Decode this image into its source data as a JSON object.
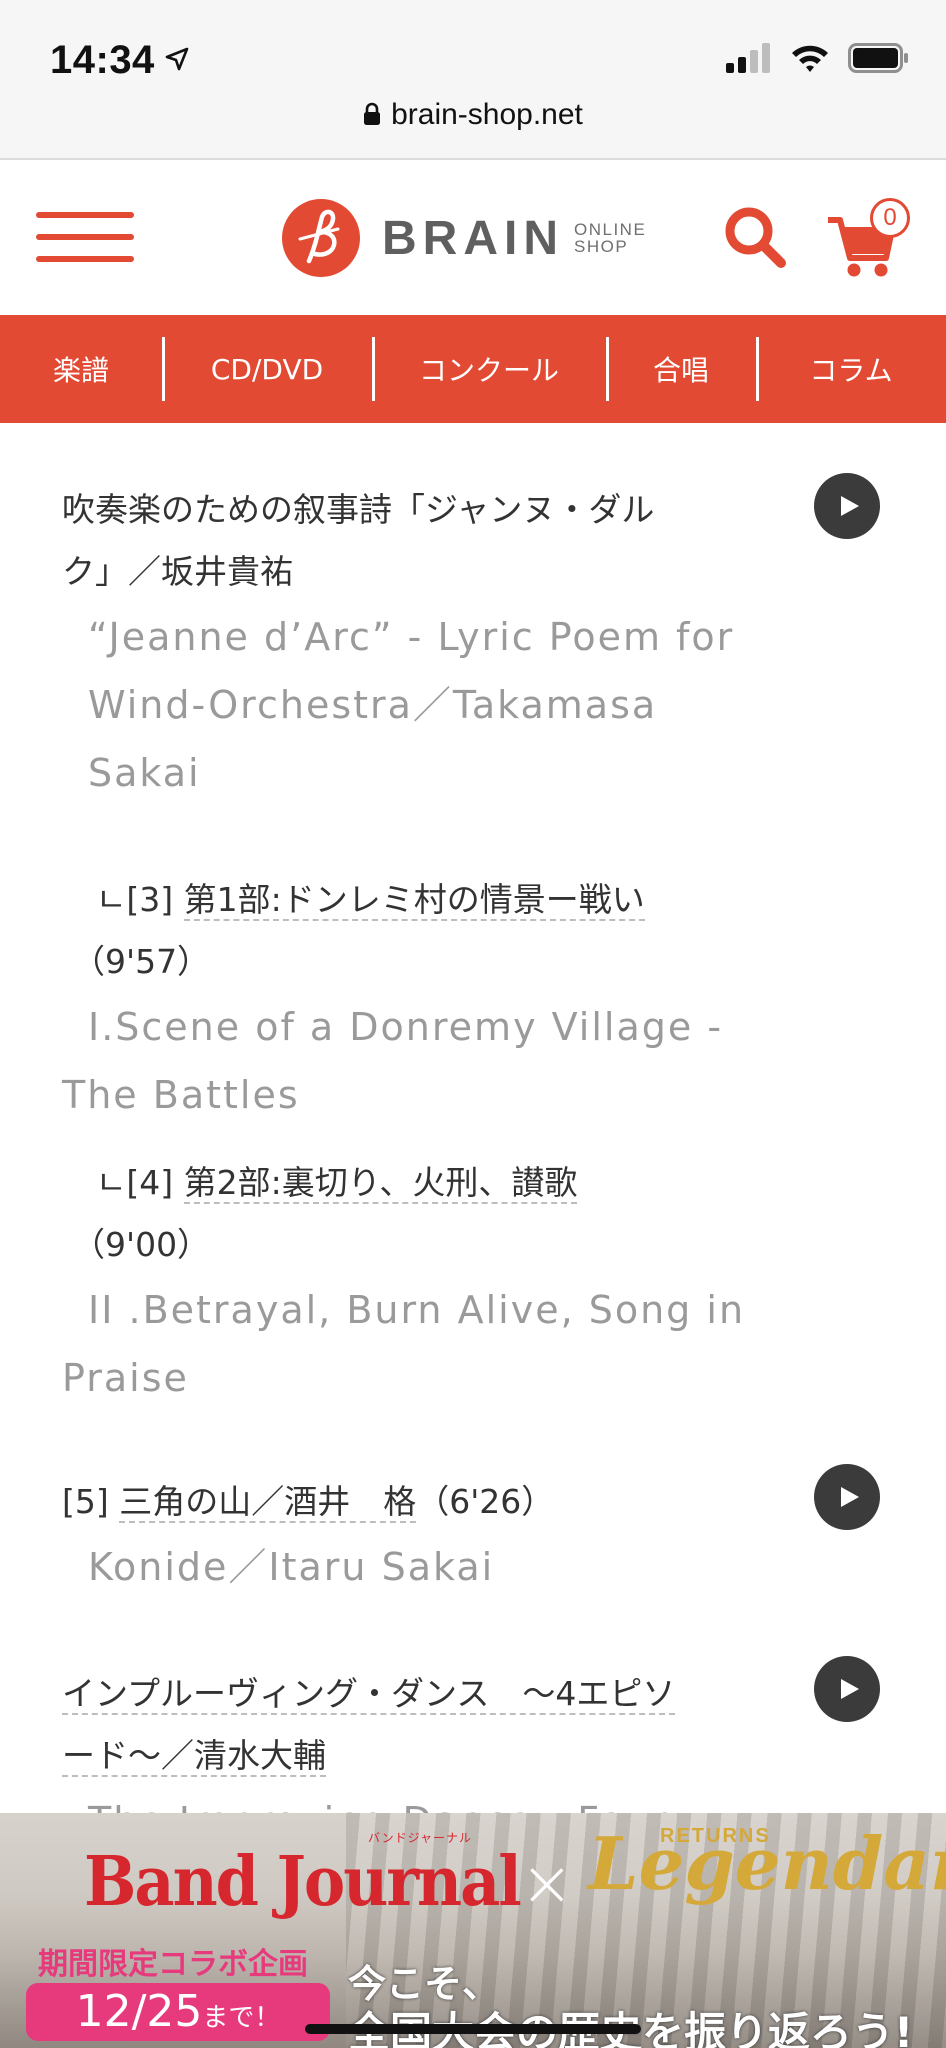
{
  "status_bar": {
    "time": "14:34",
    "url": "brain-shop.net"
  },
  "header": {
    "logo_text": "BRAIN",
    "logo_sub_1": "ONLINE",
    "logo_sub_2": "SHOP",
    "cart_count": "0",
    "accent_color": "#e24a33"
  },
  "nav": {
    "items": [
      {
        "label": "楽譜"
      },
      {
        "label": "CD/DVD"
      },
      {
        "label": "コンクール"
      },
      {
        "label": "合唱"
      },
      {
        "label": "コラム"
      }
    ]
  },
  "tracks": {
    "t1": {
      "jp_line1": "吹奏楽のための叙事詩「ジャンヌ・ダル",
      "jp_line2": "ク」／坂井貴祐",
      "en_line1": "“Jeanne d’Arc” - Lyric Poem for",
      "en_line2": "Wind-Orchestra／Takamasa",
      "en_line3": "Sakai"
    },
    "t3": {
      "prefix": "ㄴ[3] ",
      "title": "第1部:ドンレミ村の情景ー戦い",
      "duration": "（9'57）",
      "en_line1": "I.Scene of a Donremy Village -",
      "en_line2": "The Battles"
    },
    "t4": {
      "prefix": "ㄴ[4] ",
      "title": "第2部:裏切り、火刑、讃歌",
      "duration": "（9'00）",
      "en_line1": "II .Betrayal, Burn Alive, Song in",
      "en_line2": "Praise"
    },
    "t5": {
      "prefix": "[5] ",
      "title": "三角の山／酒井　格",
      "duration": "（6'26）",
      "en_line1": "Konide／Itaru Sakai"
    },
    "t6": {
      "title_line1": "インプルーヴィング・ダンス　～4エピソ",
      "title_line2": "ード～／清水大輔",
      "en_partial": "The Improving Dance - Four"
    }
  },
  "banner": {
    "title_left": "Band Journal",
    "title_left_ruby": "バンドジャーナル",
    "times": "×",
    "returns": "RETURNS",
    "title_right": "Legendary",
    "collab": "期間限定コラボ企画",
    "date": "12/25",
    "date_suffix": "まで！",
    "tagline1": "今こそ、",
    "tagline2": "全国大会の歴史を振り返ろう!"
  }
}
